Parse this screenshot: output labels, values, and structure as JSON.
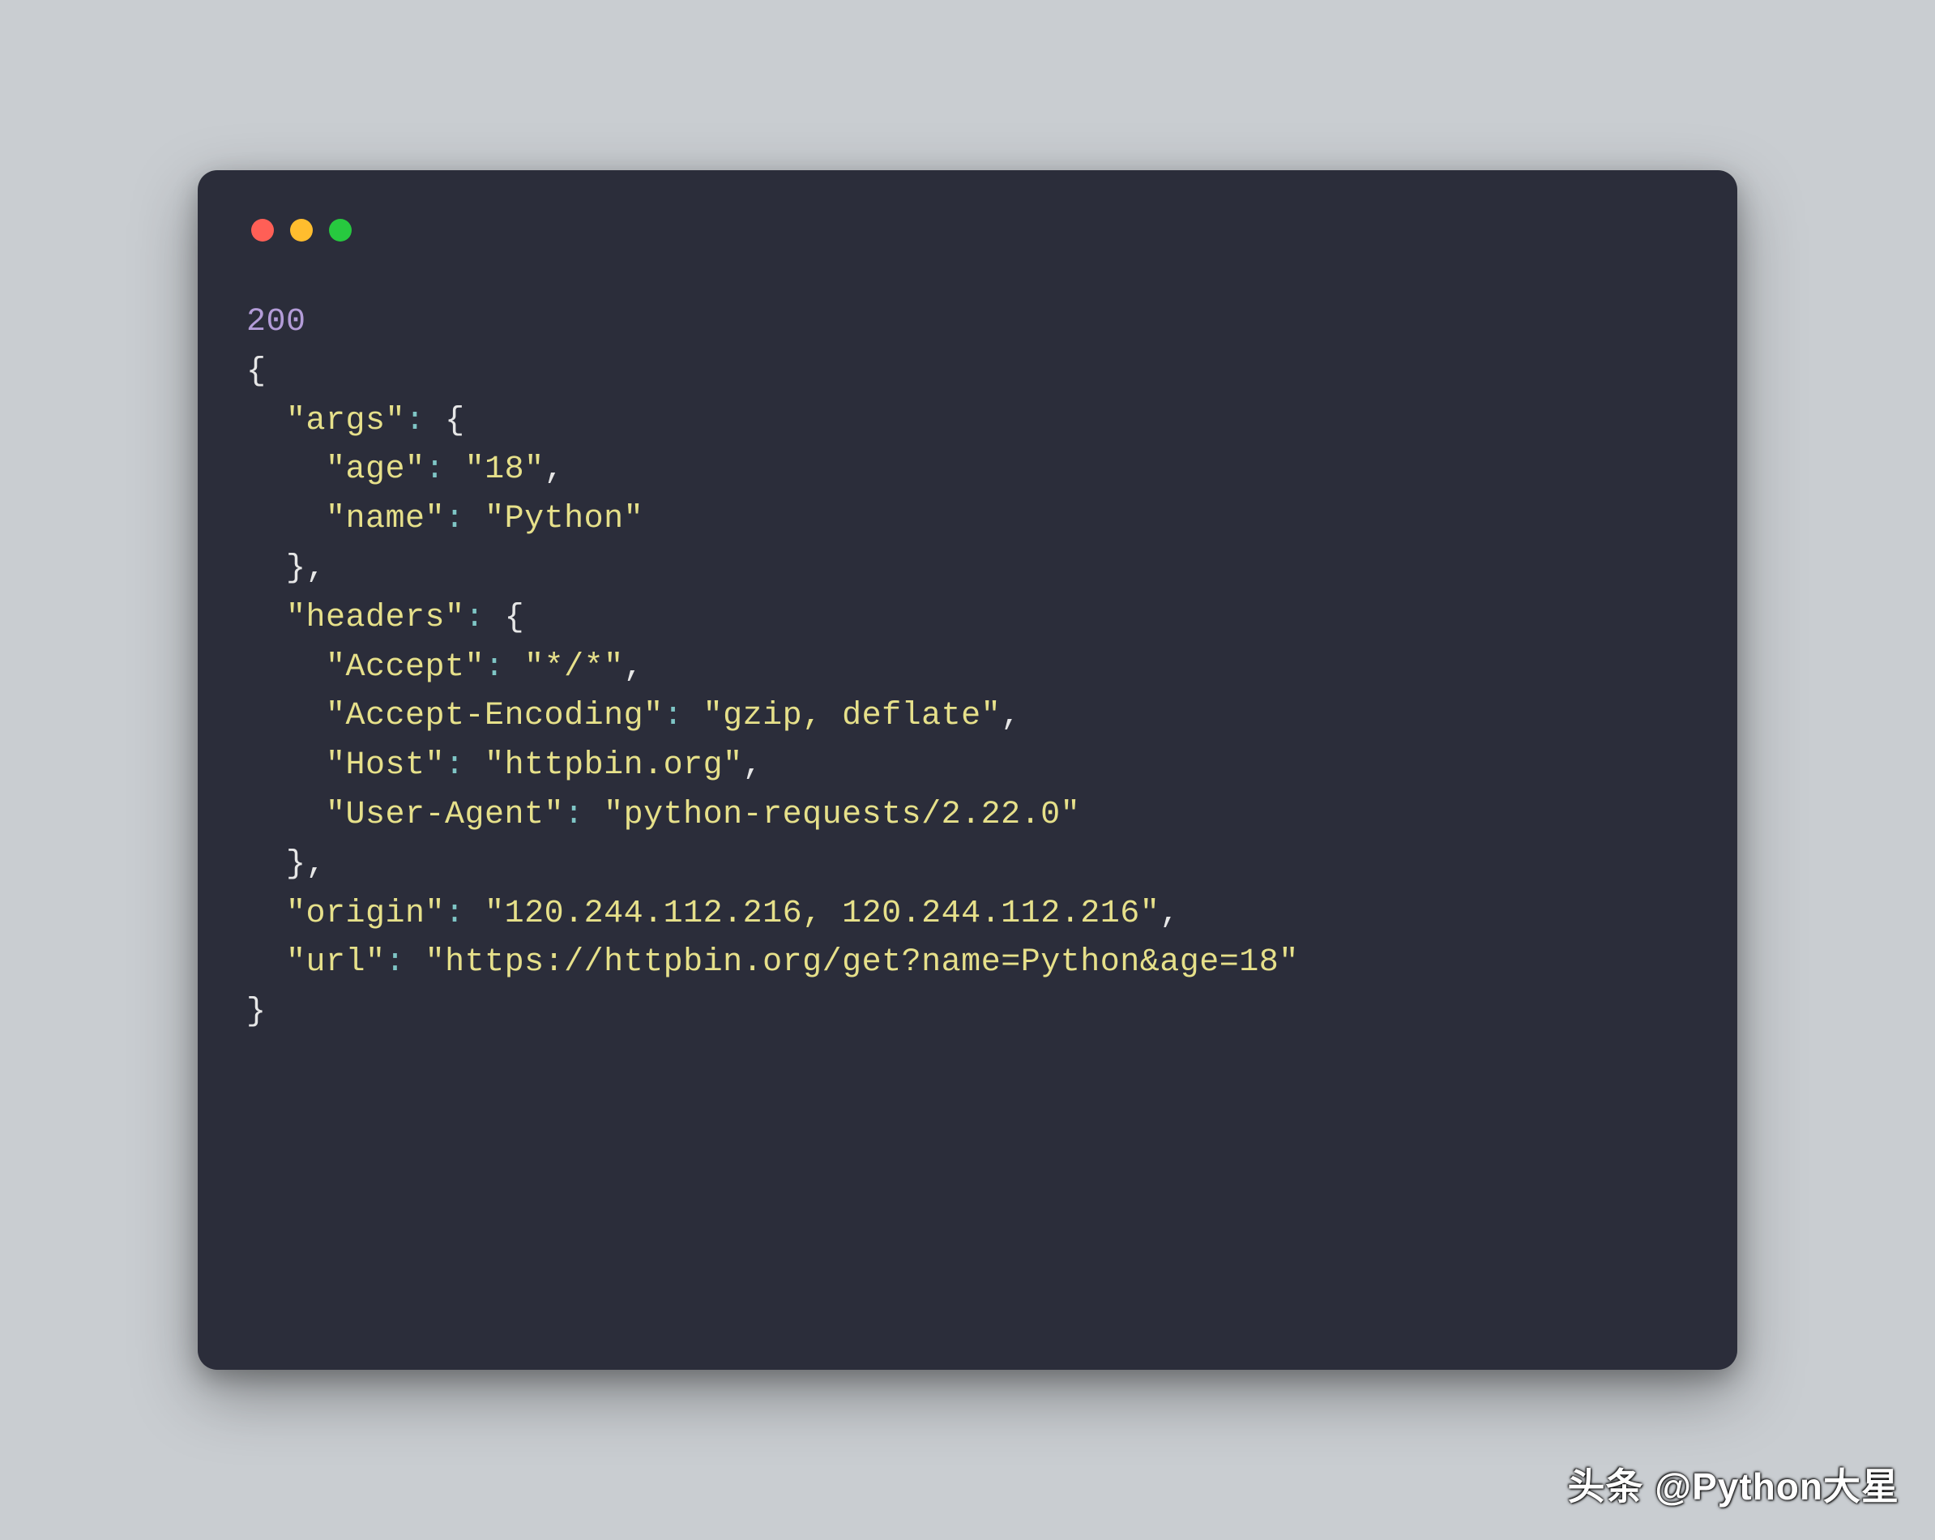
{
  "colors": {
    "close": "#ff5f56",
    "minimize": "#ffbd2e",
    "zoom": "#27c93f",
    "bg": "#2b2d3a",
    "page_bg": "#c9cdd1"
  },
  "code": {
    "status": "200",
    "brace_open": "{",
    "brace_close": "}",
    "indent1": "  ",
    "indent2": "    ",
    "args_key": "\"args\"",
    "age_key": "\"age\"",
    "age_val": "\"18\"",
    "name_key": "\"name\"",
    "name_val": "\"Python\"",
    "headers_key": "\"headers\"",
    "accept_key": "\"Accept\"",
    "accept_val": "\"*/*\"",
    "accenc_key": "\"Accept-Encoding\"",
    "accenc_val": "\"gzip, deflate\"",
    "host_key": "\"Host\"",
    "host_val": "\"httpbin.org\"",
    "ua_key": "\"User-Agent\"",
    "ua_val": "\"python-requests/2.22.0\"",
    "origin_key": "\"origin\"",
    "origin_val": "\"120.244.112.216, 120.244.112.216\"",
    "url_key": "\"url\"",
    "url_val": "\"https://httpbin.org/get?name=Python&age=18\"",
    "colon": ":",
    "comma": ",",
    "obj_open": "{",
    "obj_close": "}"
  },
  "watermark": "头条 @Python大星"
}
